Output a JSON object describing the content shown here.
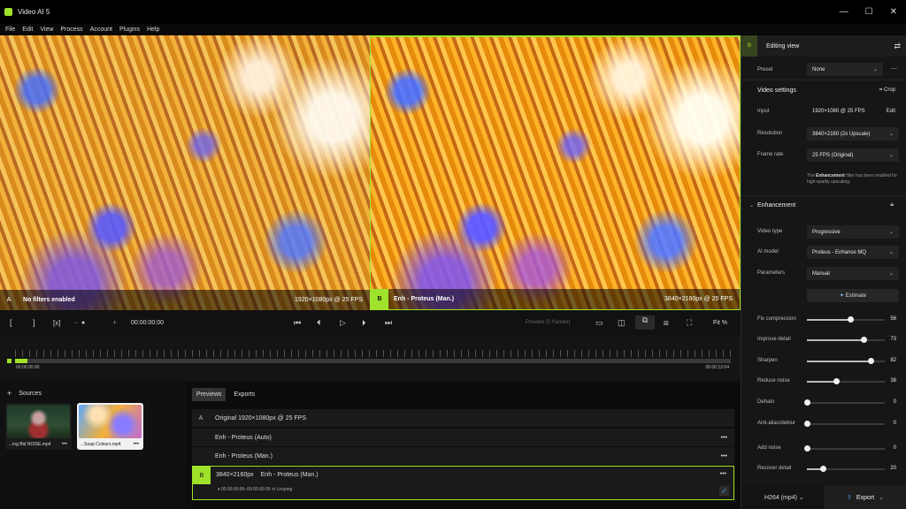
{
  "window": {
    "title": "Video AI 5",
    "controls": [
      "—",
      "☐",
      "✕"
    ]
  },
  "menu": [
    "File",
    "Edit",
    "View",
    "Process",
    "Account",
    "Plugins",
    "Help"
  ],
  "preview": {
    "left": {
      "tag": "A",
      "label": "No filters enabled",
      "resolution": "1920×1080px @ 25 FPS"
    },
    "right": {
      "tag": "B",
      "label": "Enh - Proteus (Man.)",
      "resolution": "3840×2160px @ 25 FPS"
    }
  },
  "playback": {
    "in_mark": "[",
    "out_mark": "]",
    "clear_marks": "[x]",
    "zoom_minus": "−",
    "zoom_plus": "+",
    "timecode": "00:00:00:00",
    "preview_label": "Preview (5 frames)",
    "fit": "Fit %"
  },
  "timeline": {
    "start": "00:00:00:00",
    "end": "00:00:12:04",
    "progress": 0.017
  },
  "sources": {
    "title": "Sources",
    "add": "+",
    "items": [
      {
        "name": "...ing Bid NOISE.mp4",
        "more": "•••"
      },
      {
        "name": "...Soap Colours.mp4",
        "more": "•••"
      }
    ]
  },
  "outputs": {
    "tabs": [
      "Previews",
      "Exports"
    ],
    "rows": [
      {
        "tag": "A",
        "resolution": "",
        "label": "Original   1920×1080px @ 25 FPS"
      },
      {
        "tag": "",
        "resolution": "",
        "label": "Enh - Proteus (Auto)",
        "more": "•••"
      },
      {
        "tag": "",
        "resolution": "",
        "label": "Enh - Proteus (Man.)",
        "more": "•••"
      },
      {
        "tag": "B",
        "resolution": "3840×2160px",
        "label": "Enh - Proteus (Man.)",
        "more": "•••",
        "sub": "▾ 00:00:00:00–00:00:00:05   ⟲ Looping"
      }
    ]
  },
  "panel": {
    "tag": "B",
    "title": "Editing view",
    "preset_label": "Preset",
    "preset_value": "None",
    "video_settings": "Video settings",
    "crop": "Crop",
    "input_label": "Input",
    "input_value": "1920×1080 @ 25 FPS",
    "edit": "Edit",
    "resolution_label": "Resolution",
    "resolution_value": "3840×2160 (2x Upscale)",
    "framerate_label": "Frame rate",
    "framerate_value": "25 FPS (Original)",
    "note_prefix": "The",
    "note_bold": "Enhancement",
    "note_rest": "filter has been enabled for high-quality upscaling.",
    "enhancement": "Enhancement",
    "video_type_label": "Video type",
    "video_type_value": "Progressive",
    "ai_model_label": "AI model",
    "ai_model_value": "Proteus - Enhance MQ",
    "parameters_label": "Parameters",
    "parameters_value": "Manual",
    "estimate": "Estimate",
    "sliders": [
      {
        "label": "Fix compression",
        "value": 56
      },
      {
        "label": "Improve detail",
        "value": 73
      },
      {
        "label": "Sharpen",
        "value": 82
      },
      {
        "label": "Reduce noise",
        "value": 38
      },
      {
        "label": "Dehalo",
        "value": 0
      },
      {
        "label": "Anti-alias/deblur",
        "value": 0
      },
      {
        "label": "Add noise",
        "value": 0
      },
      {
        "label": "Recover detail",
        "value": 20
      }
    ],
    "codec": "H264 (mp4)",
    "export": "Export"
  },
  "colors": {
    "accent": "#9fe22b",
    "link": "#4aa8ff"
  }
}
